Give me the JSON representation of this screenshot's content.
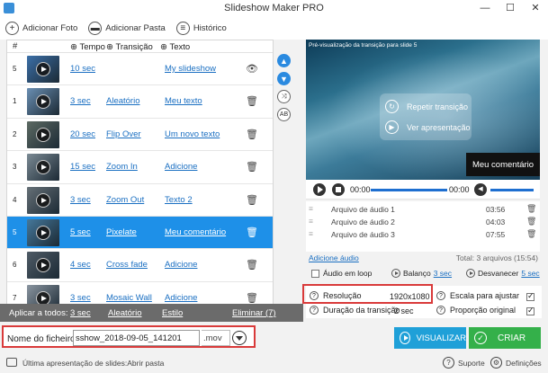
{
  "window": {
    "title": "Slideshow Maker PRO",
    "minimize": "—",
    "maximize": "☐",
    "close": "✕"
  },
  "toolbar": {
    "add_photo": "Adicionar Foto",
    "add_folder": "Adicionar Pasta",
    "history": "Histórico"
  },
  "table": {
    "headers": {
      "num": "#",
      "time": "Tempo",
      "transition": "Transição",
      "text": "Texto"
    },
    "rows": [
      {
        "num": "5",
        "time": "10 sec",
        "transition": "",
        "text": "My slideshow",
        "action": "eye-icon",
        "thumb": "#3b6fa8"
      },
      {
        "num": "1",
        "time": "3 sec",
        "transition": "Aleatório",
        "text": "Meu texto",
        "action": "trash-icon",
        "thumb": "#6a8fb3"
      },
      {
        "num": "2",
        "time": "20 sec",
        "transition": "Flip Over",
        "text": "Um novo texto",
        "action": "trash-icon",
        "thumb": "#5d6a63"
      },
      {
        "num": "3",
        "time": "15 sec",
        "transition": "Zoom In",
        "text": "Adicione",
        "action": "trash-icon",
        "thumb": "#7b8a94"
      },
      {
        "num": "4",
        "time": "3 sec",
        "transition": "Zoom Out",
        "text": "Texto 2",
        "action": "trash-icon",
        "thumb": "#667077"
      },
      {
        "num": "5",
        "time": "5 sec",
        "transition": "Pixelate",
        "text": "Meu comentário",
        "action": "trash-icon",
        "thumb": "#45789b",
        "selected": true
      },
      {
        "num": "6",
        "time": "4 sec",
        "transition": "Cross fade",
        "text": "Adicione",
        "action": "trash-icon",
        "thumb": "#4f5b66"
      },
      {
        "num": "7",
        "time": "3 sec",
        "transition": "Mosaic Wall",
        "text": "Adicione",
        "action": "trash-icon",
        "thumb": "#8a95a0"
      }
    ]
  },
  "applybar": {
    "label": "Aplicar a todos:",
    "time": "3 sec",
    "transition": "Aleatório",
    "style": "Estilo",
    "delete": "Eliminar (7)"
  },
  "preview": {
    "label": "Pré-visualização da transição para slide 5",
    "replay": "Repetir transição",
    "view": "Ver apresentação",
    "caption": "Meu comentário"
  },
  "player": {
    "current": "00:00",
    "total": "00:00"
  },
  "audio": {
    "tracks": [
      {
        "name": "Arquivo de áudio 1",
        "duration": "03:56"
      },
      {
        "name": "Arquivo de áudio 2",
        "duration": "04:03"
      },
      {
        "name": "Arquivo de áudio 3",
        "duration": "07:55"
      }
    ],
    "add": "Adicione áudio",
    "total": "Total: 3 arquivos (15:54)",
    "loop": "Áudio em loop",
    "balance_label": "Balanço",
    "balance": "3 sec",
    "fade_label": "Desvanecer",
    "fade": "5 sec"
  },
  "settings": {
    "resolution_label": "Resolução",
    "resolution": "1920x1080",
    "duration_label": "Duração da transição",
    "duration": "2 sec",
    "scale_label": "Escala para ajustar",
    "proportion_label": "Proporção original"
  },
  "file": {
    "label": "Nome do ficheiro:",
    "value": "sshow_2018-09-05_141201",
    "ext": ".mov"
  },
  "buttons": {
    "visualize": "VISUALIZAR",
    "create": "CRIAR"
  },
  "status": {
    "last": "Última apresentação de slides:Abrir pasta",
    "support": "Suporte",
    "settings": "Definições"
  },
  "colors": {
    "accent": "#1e90e8",
    "create": "#34b04a",
    "visualize": "#1fa0d8",
    "highlight": "#d93a3a"
  }
}
